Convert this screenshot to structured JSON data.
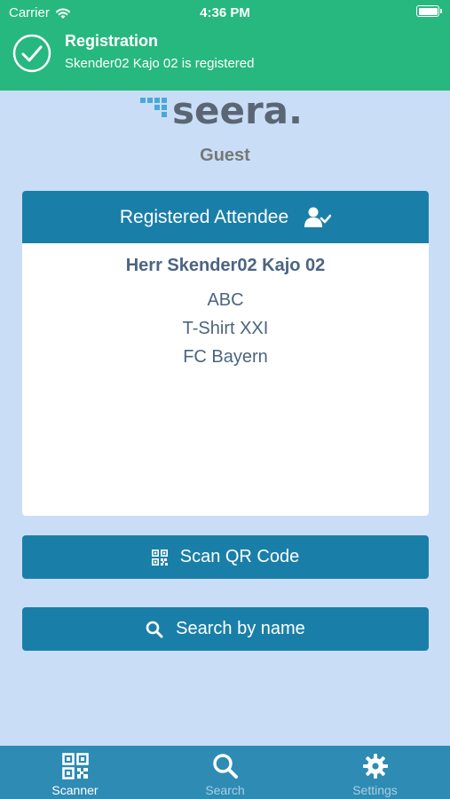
{
  "status_bar": {
    "carrier": "Carrier",
    "time": "4:36 PM"
  },
  "notification": {
    "title": "Registration",
    "message": "Skender02 Kajo 02 is registered"
  },
  "logo": {
    "text": "seera."
  },
  "role": "Guest",
  "card": {
    "header": "Registered Attendee",
    "name": "Herr Skender02 Kajo 02",
    "lines": [
      "ABC",
      "T-Shirt XXI",
      "FC Bayern"
    ]
  },
  "buttons": {
    "scan": "Scan QR Code",
    "search": "Search by name"
  },
  "tabs": [
    {
      "label": "Scanner",
      "icon": "qr-icon",
      "active": true
    },
    {
      "label": "Search",
      "icon": "search-icon",
      "active": false
    },
    {
      "label": "Settings",
      "icon": "gear-icon",
      "active": false
    }
  ],
  "colors": {
    "banner": "#27b87f",
    "primary": "#1a7fa8",
    "background": "#c9def6",
    "tabbar": "#2e8bb4"
  }
}
